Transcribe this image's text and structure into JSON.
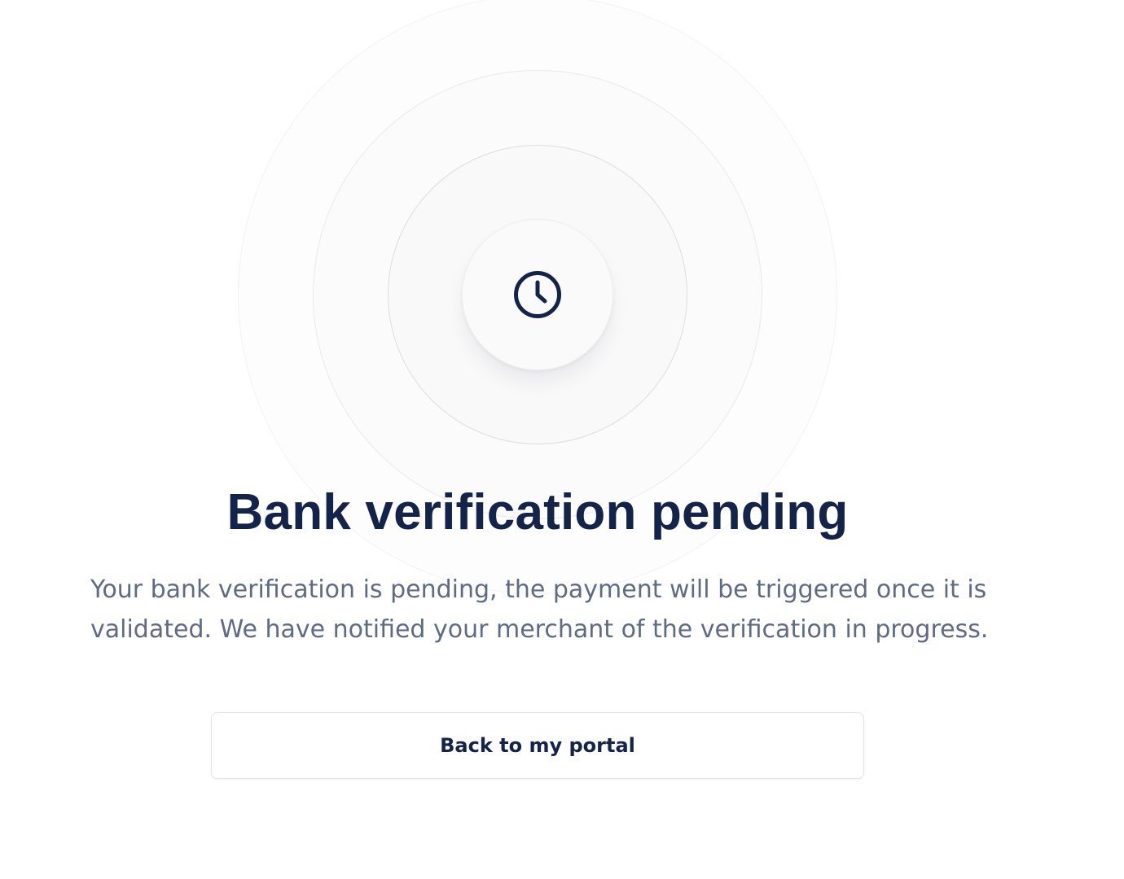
{
  "status_icon": "clock-icon",
  "colors": {
    "heading": "#14234a",
    "body_text": "#5f6b85",
    "button_border": "#e2e4e9"
  },
  "page": {
    "title": "Bank verification pending",
    "description": "Your bank verification is pending, the payment will be triggered once it is validated. We have notified your merchant of the verification in progress."
  },
  "actions": {
    "back_label": "Back to my portal"
  }
}
